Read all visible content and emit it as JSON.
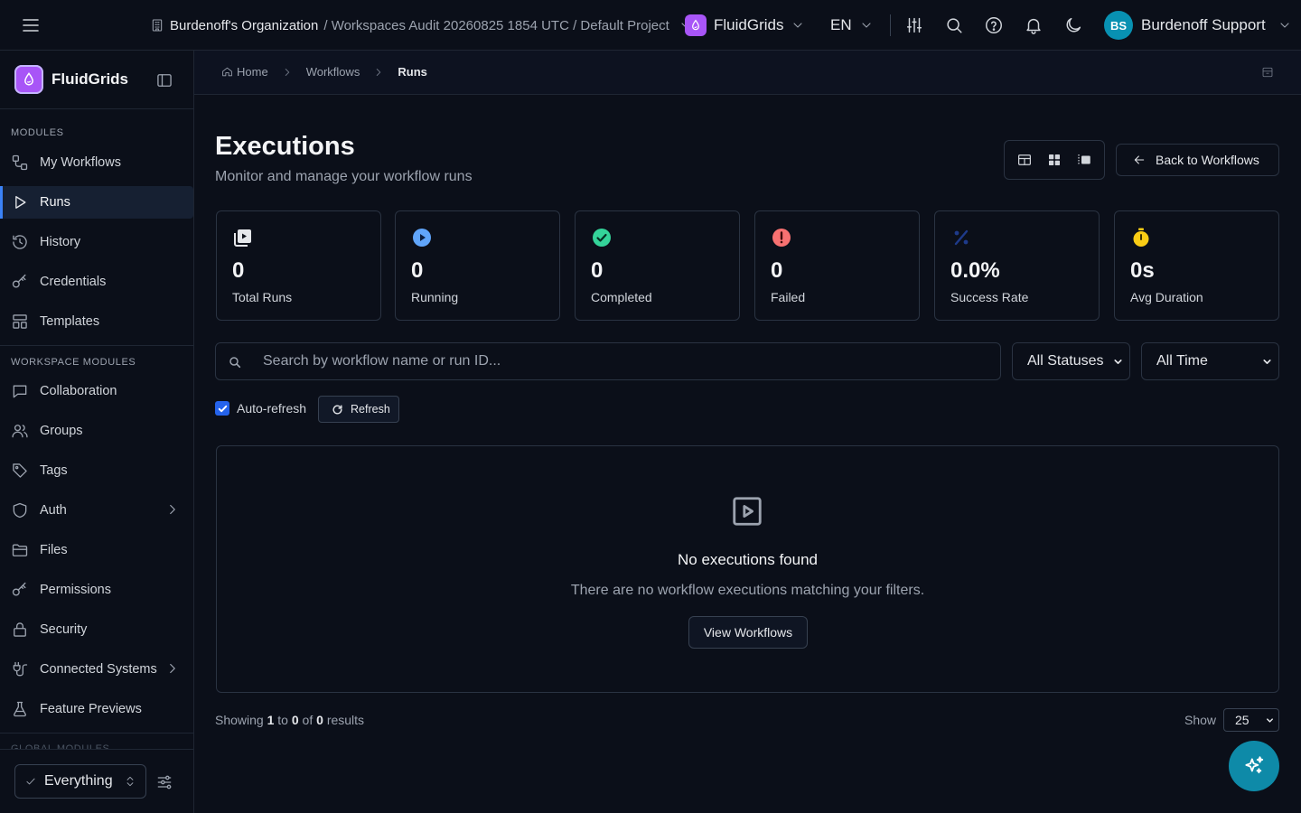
{
  "topbar": {
    "org_name": "Burdenoff's Organization",
    "org_path": "/ Workspaces Audit 20260825 1854 UTC / Default Project",
    "app_name": "FluidGrids",
    "language": "EN",
    "user_initials": "BS",
    "user_name": "Burdenoff Support",
    "icons": [
      "menu-icon",
      "building-icon",
      "chevron-down-icon",
      "sliders-icon",
      "search-icon",
      "help-icon",
      "bell-icon",
      "moon-icon"
    ]
  },
  "sidebar": {
    "brand": "FluidGrids",
    "section_modules": "MODULES",
    "modules": [
      {
        "label": "My Workflows",
        "icon": "workflow-icon"
      },
      {
        "label": "Runs",
        "icon": "play-icon",
        "active": true
      },
      {
        "label": "History",
        "icon": "history-icon"
      },
      {
        "label": "Credentials",
        "icon": "key-icon"
      },
      {
        "label": "Templates",
        "icon": "templates-icon"
      }
    ],
    "section_workspace": "WORKSPACE MODULES",
    "workspace_modules": [
      {
        "label": "Collaboration",
        "icon": "chat-icon"
      },
      {
        "label": "Groups",
        "icon": "users-icon"
      },
      {
        "label": "Tags",
        "icon": "tag-icon"
      },
      {
        "label": "Auth",
        "icon": "shield-icon",
        "has_children": true
      },
      {
        "label": "Files",
        "icon": "folder-icon"
      },
      {
        "label": "Permissions",
        "icon": "key-icon"
      },
      {
        "label": "Security",
        "icon": "lock-icon"
      },
      {
        "label": "Connected Systems",
        "icon": "plug-icon",
        "has_children": true
      },
      {
        "label": "Feature Previews",
        "icon": "flask-icon"
      }
    ],
    "section_global": "GLOBAL MODULES",
    "scope": "Everything"
  },
  "breadcrumb": {
    "home": "Home",
    "workflows": "Workflows",
    "current": "Runs"
  },
  "header": {
    "title": "Executions",
    "subtitle": "Monitor and manage your workflow runs",
    "back_button": "Back to Workflows"
  },
  "stats": [
    {
      "value": "0",
      "label": "Total Runs",
      "icon": "runs-icon",
      "color": "#e5e7eb"
    },
    {
      "value": "0",
      "label": "Running",
      "icon": "play-circle-icon",
      "color": "#60a5fa"
    },
    {
      "value": "0",
      "label": "Completed",
      "icon": "check-circle-icon",
      "color": "#34d399"
    },
    {
      "value": "0",
      "label": "Failed",
      "icon": "alert-circle-icon",
      "color": "#f87171"
    },
    {
      "value": "0.0%",
      "label": "Success Rate",
      "icon": "percent-icon",
      "color": "#1e3a8a"
    },
    {
      "value": "0s",
      "label": "Avg Duration",
      "icon": "stopwatch-icon",
      "color": "#facc15"
    }
  ],
  "filters": {
    "search_placeholder": "Search by workflow name or run ID...",
    "status": "All Statuses",
    "time": "All Time",
    "auto_refresh_label": "Auto-refresh",
    "auto_refresh_checked": true,
    "refresh_button": "Refresh"
  },
  "empty_state": {
    "title": "No executions found",
    "description": "There are no workflow executions matching your filters.",
    "button": "View Workflows"
  },
  "pagination": {
    "prefix": "Showing",
    "from": "1",
    "to_word": "to",
    "to": "0",
    "of_word": "of",
    "total": "0",
    "suffix": "results",
    "show_label": "Show",
    "page_size": "25"
  },
  "colors": {
    "accent": "#3b82f6",
    "brand": "#a855f7",
    "fab": "#0e8aa8",
    "avatar": "#0891b2"
  }
}
